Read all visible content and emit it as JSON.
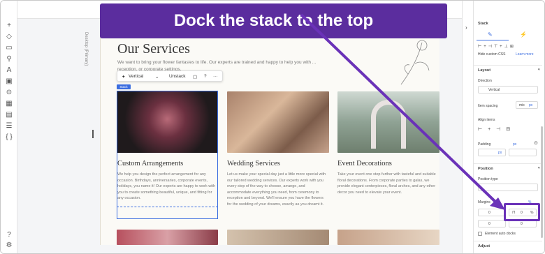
{
  "banner": {
    "text": "Dock the stack to the top"
  },
  "page": {
    "side_label": "Desktop (Primary)",
    "title": "Our Services",
    "intro": "We want to bring your flower fantasies to life. Our experts are trained and happy to help you with ... reception, or corporate settings."
  },
  "stack_toolbar": {
    "direction": "Vertical",
    "unstack": "Unstack",
    "help": "?",
    "more": "···"
  },
  "stack_tag": "Stack",
  "services": [
    {
      "title": "Custom Arrangements",
      "body": "We help you design the perfect arrangement for any occasion. Birthdays, anniversaries, corporate events, holidays, you name it! Our experts are happy to work with you to create something beautiful, unique, and fitting for any occasion."
    },
    {
      "title": "Wedding Services",
      "body": "Let us make your special day just a little more special with our tailored wedding services. Our experts work with you every step of the way to choose, arrange, and accommodate everything you need, from ceremony to reception and beyond. We'll ensure you have the flowers for the wedding of your dreams, exactly as you dreamt it."
    },
    {
      "title": "Event Decorations",
      "body": "Take your event one step further with tasteful and suitable floral decorations. From corporate parties to galas, we provide elegant centerpieces, floral arches, and any other decor you need to elevate your event."
    }
  ],
  "panel": {
    "header": "Stack",
    "hide_css": "Hide custom CSS",
    "learn_more": "Learn more",
    "layout": "Layout",
    "direction_label": "Direction",
    "direction_value": "Vertical",
    "item_spacing_label": "Item spacing",
    "item_spacing_value": "mix",
    "item_spacing_unit": "px",
    "align_items": "Align items",
    "padding_label": "Padding",
    "padding_unit": "px",
    "padding_value_unit": "px",
    "position": "Position",
    "position_type": "Position type",
    "margins_label": "Margins",
    "margins_unit": "%",
    "field_a": "0",
    "field_b": "0",
    "field_c": "%",
    "field_d": "0",
    "field_e": "0",
    "auto_docks": "Element auto docks",
    "adjust": "Adjust"
  },
  "colors": {
    "accent": "#3b6de0",
    "banner": "#5b2d9e",
    "annotation": "#6a32b8"
  }
}
